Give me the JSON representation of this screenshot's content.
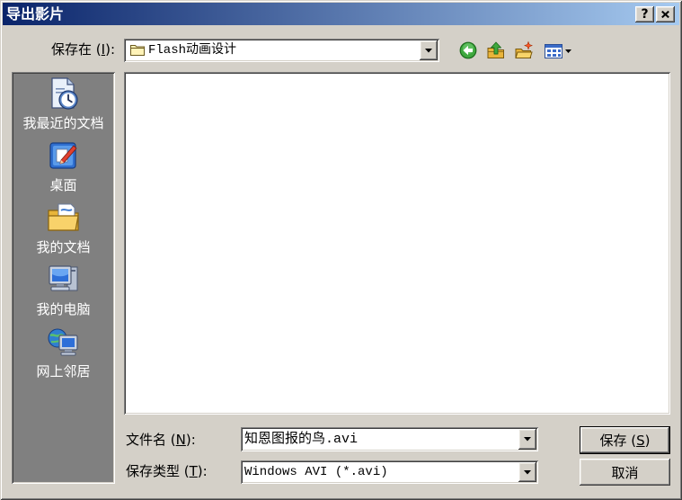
{
  "colors": {
    "face": "#D4D0C8",
    "title_from": "#0A246A",
    "title_to": "#A6CAF0",
    "title_text": "#FFFFFF",
    "places_bg": "#808080",
    "places_text": "#FFFFFF",
    "list_bg": "#FFFFFF"
  },
  "window": {
    "title": "导出影片",
    "help_label": "?",
    "close_icon": "close-icon"
  },
  "save_in": {
    "label": {
      "before": "保存在 (",
      "key": "I",
      "after": "):"
    },
    "value": "Flash动画设计",
    "value_icon": "folder-icon",
    "dropdown_icon": "dropdown-arrow-icon"
  },
  "toolbar": {
    "back_icon": "back-arrow-icon",
    "up_icon": "up-one-level-icon",
    "new_folder_icon": "new-folder-icon",
    "views_icon": "views-menu-icon"
  },
  "places": {
    "items": [
      {
        "label": "我最近的文档",
        "icon": "recent-documents-icon"
      },
      {
        "label": "桌面",
        "icon": "desktop-icon"
      },
      {
        "label": "我的文档",
        "icon": "my-documents-icon"
      },
      {
        "label": "我的电脑",
        "icon": "my-computer-icon"
      },
      {
        "label": "网上邻居",
        "icon": "network-places-icon"
      }
    ]
  },
  "file_list": {
    "items": []
  },
  "file_name": {
    "label": {
      "before": "文件名 (",
      "key": "N",
      "after": "):"
    },
    "value": "知恩图报的鸟.avi"
  },
  "save_type": {
    "label": {
      "before": "保存类型 (",
      "key": "T",
      "after": "):"
    },
    "value": "Windows AVI (*.avi)"
  },
  "buttons": {
    "save": {
      "before": "保存 (",
      "key": "S",
      "after": ")"
    },
    "cancel": "取消"
  }
}
